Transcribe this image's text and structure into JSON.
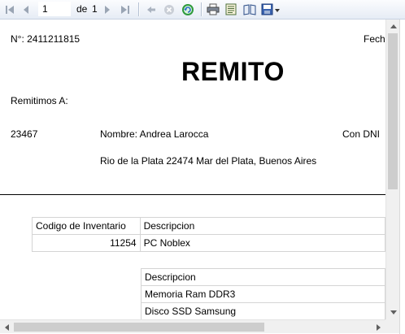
{
  "toolbar": {
    "page_value": "1",
    "of_label": "de",
    "total_pages": "1",
    "icons": [
      "first-page-icon",
      "previous-page-icon",
      "next-page-icon",
      "last-page-icon",
      "back-icon",
      "stop-icon",
      "refresh-icon",
      "print-icon",
      "print-layout-icon",
      "page-setup-icon",
      "export-icon"
    ]
  },
  "report": {
    "number": "N°: 2411211815",
    "date_label": "Fech",
    "title": "REMITO",
    "remitimos_label": "Remitimos A:",
    "client_code": "23467",
    "nombre": "Nombre: Andrea Larocca",
    "dni_label": "Con DNI",
    "address": "Rio de la Plata 22474 Mar del Plata, Buenos Aires",
    "table1": {
      "headers": [
        "Codigo de  Inventario",
        "Descripcion"
      ],
      "rows": [
        [
          "11254",
          "PC Noblex"
        ]
      ]
    },
    "table2": {
      "header": "Descripcion",
      "rows": [
        "Memoria Ram DDR3",
        "Disco SSD Samsung"
      ]
    }
  }
}
